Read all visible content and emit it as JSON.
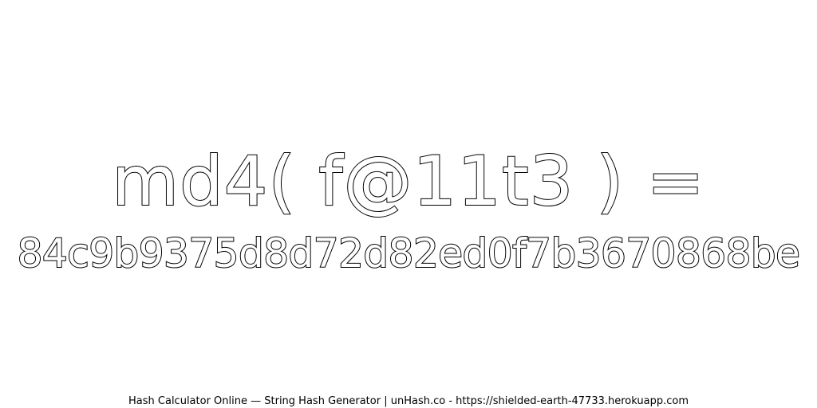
{
  "headline": {
    "text": "md4( f@11t3 ) ="
  },
  "hash": {
    "value": "84c9b9375d8d72d82ed0f7b3670868be"
  },
  "footer": {
    "text": "Hash Calculator Online — String Hash Generator | unHash.co - https://shielded-earth-47733.herokuapp.com"
  },
  "colors": {
    "background": "#ffffff",
    "text_fill": "#ffffff",
    "text_outline": "#000000"
  }
}
